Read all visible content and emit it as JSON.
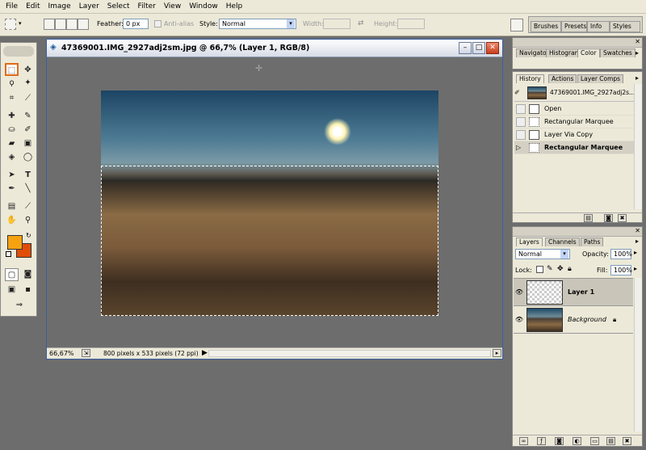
{
  "menu": [
    "File",
    "Edit",
    "Image",
    "Layer",
    "Select",
    "Filter",
    "View",
    "Window",
    "Help"
  ],
  "options": {
    "feather_label": "Feather:",
    "feather_value": "0 px",
    "antialias_label": "Anti-alias",
    "style_label": "Style:",
    "style_value": "Normal",
    "width_label": "Width:",
    "height_label": "Height:"
  },
  "palette_well": [
    "Brushes",
    "Presets",
    "Info",
    "Styles"
  ],
  "document": {
    "title": "47369001.IMG_2927adj2sm.jpg @ 66,7% (Layer 1, RGB/8)",
    "zoom": "66,67%",
    "info": "800 pixels x 533 pixels (72 ppi)"
  },
  "colors": {
    "foreground": "#f5a211",
    "background": "#e04d08"
  },
  "navigator_tabs": [
    "Navigator",
    "Histogram",
    "Color",
    "Swatches"
  ],
  "history": {
    "tabs": [
      "History",
      "Actions",
      "Layer Comps"
    ],
    "snapshot": "47369001.IMG_2927adj2s...",
    "steps": [
      "Open",
      "Rectangular Marquee",
      "Layer Via Copy",
      "Rectangular Marquee"
    ]
  },
  "layers": {
    "tabs": [
      "Layers",
      "Channels",
      "Paths"
    ],
    "blend_mode": "Normal",
    "opacity_label": "Opacity:",
    "opacity": "100%",
    "lock_label": "Lock:",
    "fill_label": "Fill:",
    "fill": "100%",
    "items": [
      "Layer 1",
      "Background"
    ]
  }
}
